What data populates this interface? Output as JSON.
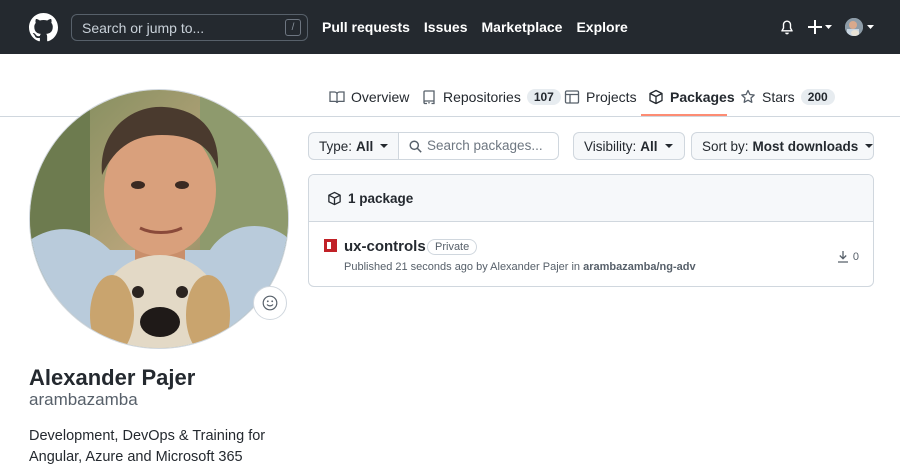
{
  "header": {
    "search_placeholder": "Search or jump to...",
    "search_shortcut": "/",
    "nav": [
      "Pull requests",
      "Issues",
      "Marketplace",
      "Explore"
    ],
    "icons": [
      "github-logo-icon",
      "bell-icon",
      "plus-icon",
      "avatar"
    ]
  },
  "tabs": {
    "overview": "Overview",
    "repositories": "Repositories",
    "repositories_count": "107",
    "projects": "Projects",
    "packages": "Packages",
    "stars": "Stars",
    "stars_count": "200",
    "selected": "Packages"
  },
  "profile": {
    "full_name": "Alexander Pajer",
    "login": "arambazamba",
    "bio_line1": "Development, DevOps & Training for",
    "bio_line2": "Angular, Azure and Microsoft 365"
  },
  "filters": {
    "type_label": "Type:",
    "type_value": "All",
    "search_placeholder": "Search packages...",
    "visibility_label": "Visibility:",
    "visibility_value": "All",
    "sort_label": "Sort by:",
    "sort_value": "Most downloads"
  },
  "packages": {
    "count_label": "1 package",
    "items": [
      {
        "name": "ux-controls",
        "badge": "Private",
        "published_text": "Published 21 seconds ago by Alexander Pajer in",
        "repo": "arambazamba/ng-adv",
        "downloads": "0"
      }
    ]
  },
  "colors": {
    "header_bg": "#24292f",
    "tab_underline": "#fd8c73",
    "npm_red": "#c12127"
  }
}
